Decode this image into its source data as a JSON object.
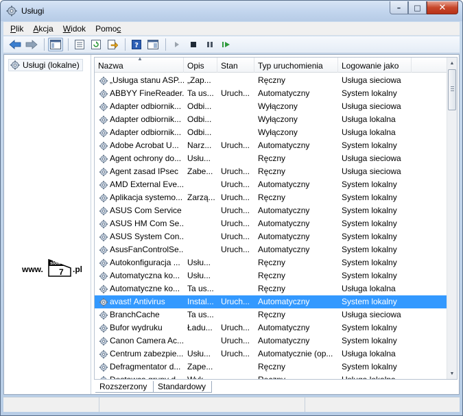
{
  "window": {
    "title": "Usługi"
  },
  "menu": [
    {
      "pre": "",
      "u": "P",
      "post": "lik"
    },
    {
      "pre": "",
      "u": "A",
      "post": "kcja"
    },
    {
      "pre": "",
      "u": "W",
      "post": "idok"
    },
    {
      "pre": "Pomo",
      "u": "c",
      "post": ""
    }
  ],
  "toolbar": {
    "buttons": [
      "back-icon",
      "forward-icon",
      "console-tree-icon",
      "properties-icon",
      "refresh-icon",
      "export-icon",
      "help-icon",
      "view-icon",
      "start-service-icon",
      "stop-service-icon",
      "pause-service-icon",
      "restart-service-icon"
    ]
  },
  "tree": {
    "label": "Usługi (lokalne)"
  },
  "watermark": {
    "prefix": "www.",
    "badge_top": "slow",
    "badge_num": "7",
    "suffix": ".pl"
  },
  "columns": {
    "name": "Nazwa",
    "opis": "Opis",
    "stan": "Stan",
    "typ": "Typ uruchomienia",
    "log": "Logowanie jako"
  },
  "rows": [
    {
      "name": "„Usługa stanu ASP...",
      "opis": "„Zap...",
      "stan": "",
      "typ": "Ręczny",
      "log": "Usługa sieciowa"
    },
    {
      "name": "ABBYY FineReader...",
      "opis": "Ta us...",
      "stan": "Uruch...",
      "typ": "Automatyczny",
      "log": "System lokalny"
    },
    {
      "name": "Adapter odbiornik...",
      "opis": "Odbi...",
      "stan": "",
      "typ": "Wyłączony",
      "log": "Usługa sieciowa"
    },
    {
      "name": "Adapter odbiornik...",
      "opis": "Odbi...",
      "stan": "",
      "typ": "Wyłączony",
      "log": "Usługa lokalna"
    },
    {
      "name": "Adapter odbiornik...",
      "opis": "Odbi...",
      "stan": "",
      "typ": "Wyłączony",
      "log": "Usługa lokalna"
    },
    {
      "name": "Adobe Acrobat U...",
      "opis": "Narz...",
      "stan": "Uruch...",
      "typ": "Automatyczny",
      "log": "System lokalny"
    },
    {
      "name": "Agent ochrony do...",
      "opis": "Usłu...",
      "stan": "",
      "typ": "Ręczny",
      "log": "Usługa sieciowa"
    },
    {
      "name": "Agent zasad IPsec",
      "opis": "Zabe...",
      "stan": "Uruch...",
      "typ": "Ręczny",
      "log": "Usługa sieciowa"
    },
    {
      "name": "AMD External Eve...",
      "opis": "",
      "stan": "Uruch...",
      "typ": "Automatyczny",
      "log": "System lokalny"
    },
    {
      "name": "Aplikacja systemo...",
      "opis": "Zarzą...",
      "stan": "Uruch...",
      "typ": "Ręczny",
      "log": "System lokalny"
    },
    {
      "name": "ASUS Com Service",
      "opis": "",
      "stan": "Uruch...",
      "typ": "Automatyczny",
      "log": "System lokalny"
    },
    {
      "name": "ASUS HM Com Se...",
      "opis": "",
      "stan": "Uruch...",
      "typ": "Automatyczny",
      "log": "System lokalny"
    },
    {
      "name": "ASUS System Con...",
      "opis": "",
      "stan": "Uruch...",
      "typ": "Automatyczny",
      "log": "System lokalny"
    },
    {
      "name": "AsusFanControlSe...",
      "opis": "",
      "stan": "Uruch...",
      "typ": "Automatyczny",
      "log": "System lokalny"
    },
    {
      "name": "Autokonfiguracja ...",
      "opis": "Usłu...",
      "stan": "",
      "typ": "Ręczny",
      "log": "System lokalny"
    },
    {
      "name": "Automatyczna ko...",
      "opis": "Usłu...",
      "stan": "",
      "typ": "Ręczny",
      "log": "System lokalny"
    },
    {
      "name": "Automatyczne ko...",
      "opis": "Ta us...",
      "stan": "",
      "typ": "Ręczny",
      "log": "Usługa lokalna"
    },
    {
      "name": "avast! Antivirus",
      "opis": "Instal...",
      "stan": "Uruch...",
      "typ": "Automatyczny",
      "log": "System lokalny",
      "selected": true
    },
    {
      "name": "BranchCache",
      "opis": "Ta us...",
      "stan": "",
      "typ": "Ręczny",
      "log": "Usługa sieciowa"
    },
    {
      "name": "Bufor wydruku",
      "opis": "Ładu...",
      "stan": "Uruch...",
      "typ": "Automatyczny",
      "log": "System lokalny"
    },
    {
      "name": "Canon Camera Ac...",
      "opis": "",
      "stan": "Uruch...",
      "typ": "Automatyczny",
      "log": "System lokalny"
    },
    {
      "name": "Centrum zabezpie...",
      "opis": "Usłu...",
      "stan": "Uruch...",
      "typ": "Automatycznie (op...",
      "log": "Usługa lokalna"
    },
    {
      "name": "Defragmentator d...",
      "opis": "Zape...",
      "stan": "",
      "typ": "Ręczny",
      "log": "System lokalny"
    },
    {
      "name": "Dostawca grupy d...",
      "opis": "Wyk...",
      "stan": "",
      "typ": "Ręczny",
      "log": "Usługa lokalna"
    }
  ],
  "tabs": {
    "extended": "Rozszerzony",
    "standard": "Standardowy"
  },
  "colors": {
    "selection": "#3399ff",
    "title_gradient_top": "#d7e5f5",
    "close_button": "#c7472a"
  }
}
